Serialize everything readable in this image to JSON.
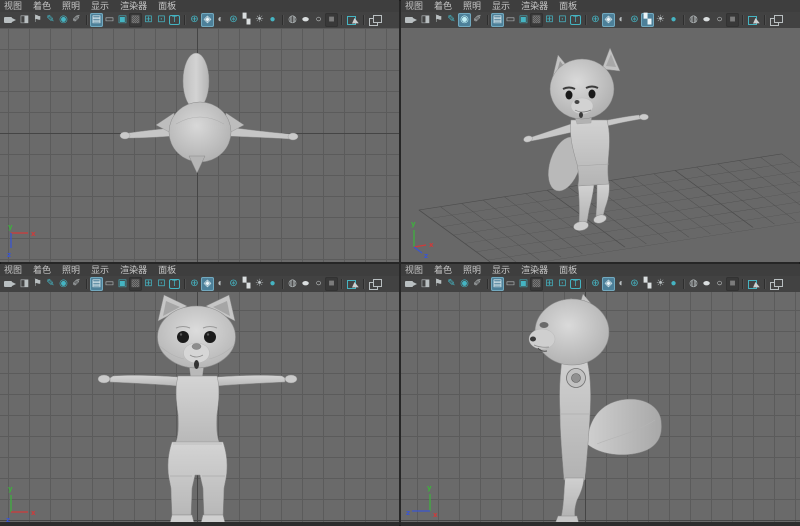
{
  "app": "maya-four-view-panel",
  "colors": {
    "teal_accent": "#45b4c2",
    "icon_gray": "#b9bfc1",
    "active_icon_bg": "#4d8099",
    "menubar_bg": "#3e3e3e",
    "toolbar_bg": "#424242",
    "viewport_bg": "#6a6a6a",
    "grid_line": "#5b5b5b",
    "axis_x_red": "#d03a3a",
    "axis_y_green": "#3fae3f",
    "axis_z_blue": "#3a56d0",
    "model_gray": "#c9c9c9"
  },
  "menu_items": [
    {
      "name": "view",
      "label": "视图"
    },
    {
      "name": "shading",
      "label": "着色"
    },
    {
      "name": "lighting",
      "label": "照明"
    },
    {
      "name": "show",
      "label": "显示"
    },
    {
      "name": "renderer",
      "label": "渲染器"
    },
    {
      "name": "panels",
      "label": "面板"
    }
  ],
  "toolbar_icons": [
    {
      "name": "camera-icon",
      "type": "camera"
    },
    {
      "name": "camera-attributes-icon",
      "glyph": "◨",
      "color": "gray"
    },
    {
      "name": "bookmark-icon",
      "glyph": "⚑",
      "color": "gray"
    },
    {
      "name": "grease-pencil-icon",
      "glyph": "✎",
      "color": "teal"
    },
    {
      "name": "pan-zoom-icon",
      "glyph": "◉",
      "color": "teal"
    },
    {
      "name": "pencil-icon",
      "glyph": "✐",
      "color": "gray"
    },
    {
      "type": "sep"
    },
    {
      "name": "grid-icon",
      "glyph": "▤",
      "color": "gray"
    },
    {
      "name": "film-gate-icon",
      "glyph": "▭",
      "color": "gray"
    },
    {
      "name": "resolution-gate-icon",
      "glyph": "▣",
      "color": "teal"
    },
    {
      "name": "gate-mask-icon",
      "glyph": "▩",
      "color": "dim"
    },
    {
      "name": "field-chart-icon",
      "glyph": "⊞",
      "color": "teal"
    },
    {
      "name": "safe-action-icon",
      "glyph": "⊡",
      "color": "teal"
    },
    {
      "name": "safe-title-icon",
      "type": "boxT",
      "glyph": "T",
      "color": "teal"
    },
    {
      "type": "sep"
    },
    {
      "name": "wireframe-sphere-icon",
      "glyph": "⊕",
      "color": "teal"
    },
    {
      "name": "shaded-cube-icon",
      "glyph": "◈",
      "color": "white"
    },
    {
      "name": "wireframe-on-shaded-icon",
      "glyph": "◐",
      "color": "gray"
    },
    {
      "name": "textured-sphere-icon",
      "glyph": "⊛",
      "color": "teal"
    },
    {
      "name": "checker-material-icon",
      "glyph": "▚",
      "color": "white"
    },
    {
      "name": "light-icon",
      "glyph": "☀",
      "color": "gray"
    },
    {
      "name": "shadow-icon",
      "glyph": "●",
      "color": "teal"
    },
    {
      "type": "sep"
    },
    {
      "name": "ao-sphere-icon",
      "glyph": "◍",
      "color": "gray"
    },
    {
      "name": "motion-blur-icon",
      "glyph": "●",
      "color": "white",
      "wide": true
    },
    {
      "name": "antialias-icon",
      "glyph": "○",
      "color": "white"
    },
    {
      "name": "depth-of-field-icon",
      "glyph": "■",
      "color": "dim"
    },
    {
      "type": "sep"
    },
    {
      "name": "select-cursor-icon",
      "type": "cursor"
    },
    {
      "type": "sep"
    },
    {
      "name": "isolate-select-icon",
      "type": "overlap"
    }
  ],
  "viewports": [
    {
      "name": "top-view",
      "active_icons": [
        "grid-icon",
        "shaded-cube-icon"
      ]
    },
    {
      "name": "persp-view",
      "active_icons": [
        "pan-zoom-icon",
        "grid-icon",
        "shaded-cube-icon",
        "checker-material-icon"
      ]
    },
    {
      "name": "front-view",
      "active_icons": [
        "grid-icon",
        "shaded-cube-icon"
      ]
    },
    {
      "name": "side-view",
      "active_icons": [
        "grid-icon",
        "shaded-cube-icon"
      ]
    }
  ],
  "axis_labels": {
    "x": "x",
    "y": "y",
    "z": "z"
  }
}
